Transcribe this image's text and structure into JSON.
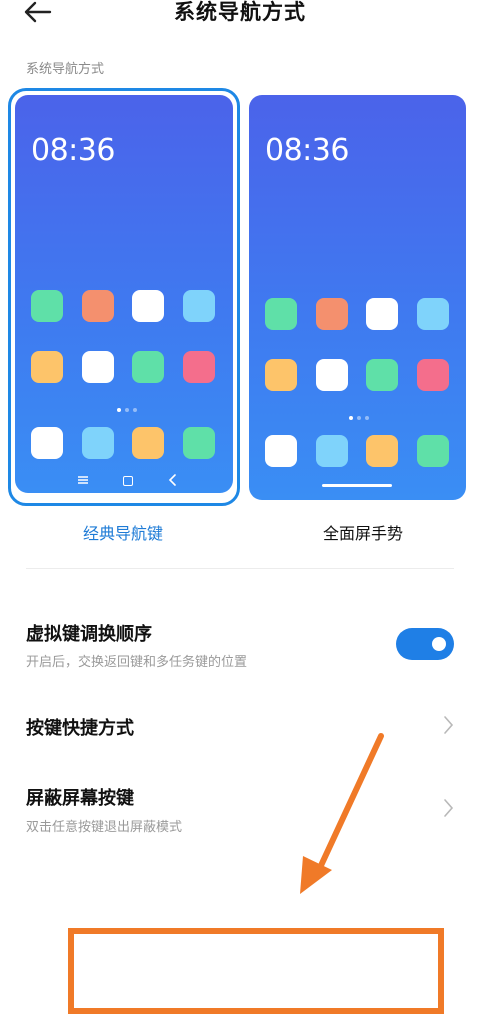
{
  "header": {
    "title": "系统导航方式",
    "back_icon": "back-arrow-icon"
  },
  "section_label": "系统导航方式",
  "nav_options": [
    {
      "label": "经典导航键",
      "clock": "08:36",
      "selected": true
    },
    {
      "label": "全面屏手势",
      "clock": "08:36",
      "selected": false
    }
  ],
  "settings": [
    {
      "title": "虚拟键调换顺序",
      "description": "开启后，交换返回键和多任务键的位置",
      "toggle_on": true
    },
    {
      "title": "按键快捷方式",
      "chevron_icon": "chevron-right-icon"
    },
    {
      "title": "屏蔽屏幕按键",
      "description": "双击任意按键退出屏蔽模式",
      "chevron_icon": "chevron-right-icon"
    }
  ],
  "colors": {
    "accent": "#1e88e5",
    "toggle_on": "#1f7fe6",
    "annotation": "#f07a28",
    "icon_green": "#5fe0a8",
    "icon_salmon": "#f4906e",
    "icon_white": "#ffffff",
    "icon_lightblue": "#7fd3fb",
    "icon_yellow": "#fdc46a",
    "icon_pink": "#f46e8c"
  },
  "icon_rows": [
    [
      "icon_green",
      "icon_salmon",
      "icon_white",
      "icon_lightblue"
    ],
    [
      "icon_yellow",
      "icon_white",
      "icon_green",
      "icon_pink"
    ],
    [
      "icon_white",
      "icon_lightblue",
      "icon_yellow",
      "icon_green"
    ]
  ]
}
